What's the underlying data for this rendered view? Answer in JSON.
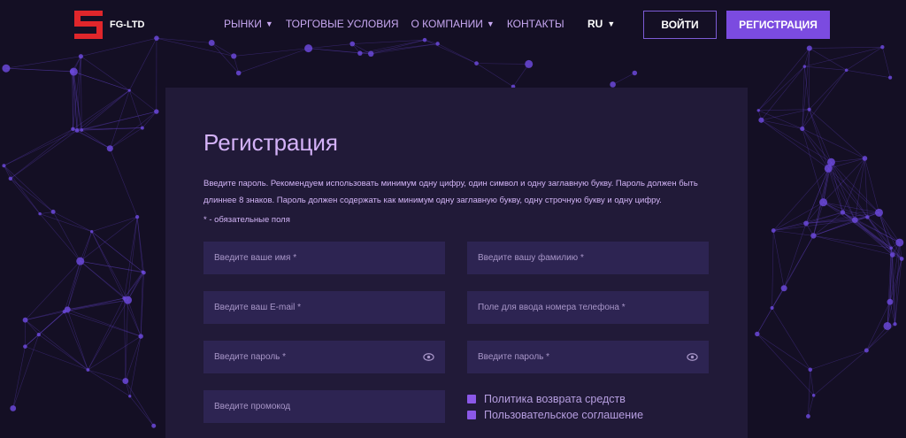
{
  "header": {
    "logo_text": "FG-LTD",
    "nav": [
      {
        "label": "РЫНКИ",
        "dropdown": true
      },
      {
        "label": "ТОРГОВЫЕ УСЛОВИЯ",
        "dropdown": false
      },
      {
        "label": "О КОМПАНИИ",
        "dropdown": true
      },
      {
        "label": "КОНТАКТЫ",
        "dropdown": false
      }
    ],
    "language": "RU",
    "login_label": "ВОЙТИ",
    "register_label": "РЕГИСТРАЦИЯ"
  },
  "form": {
    "title": "Регистрация",
    "description": "Введите пароль. Рекомендуем использовать минимум одну цифру, один символ и одну заглавную букву. Пароль должен быть длиннее 8 знаков. Пароль должен содержать как минимум одну заглавную букву, одну строчную букву и одну цифру.",
    "required_note": "* - обязательные поля",
    "fields": {
      "first_name": "Введите ваше имя *",
      "last_name": "Введите вашу фамилию *",
      "email": "Введите ваш E-mail *",
      "phone": "Поле для ввода номера телефона *",
      "password": "Введите пароль *",
      "password_confirm": "Введите пароль *",
      "promo": "Введите промокод"
    },
    "checkboxes": [
      {
        "label": "Политика возврата средств",
        "checked": true
      },
      {
        "label": "Пользовательское соглашение",
        "checked": true
      }
    ]
  },
  "colors": {
    "background": "#140f24",
    "card": "#211a38",
    "field": "#2d2452",
    "accent": "#7b4be0",
    "brand_red": "#e0262b",
    "network_node": "#6a48d8"
  },
  "icons": [
    "logo-icon",
    "caret-down-icon",
    "eye-icon"
  ]
}
